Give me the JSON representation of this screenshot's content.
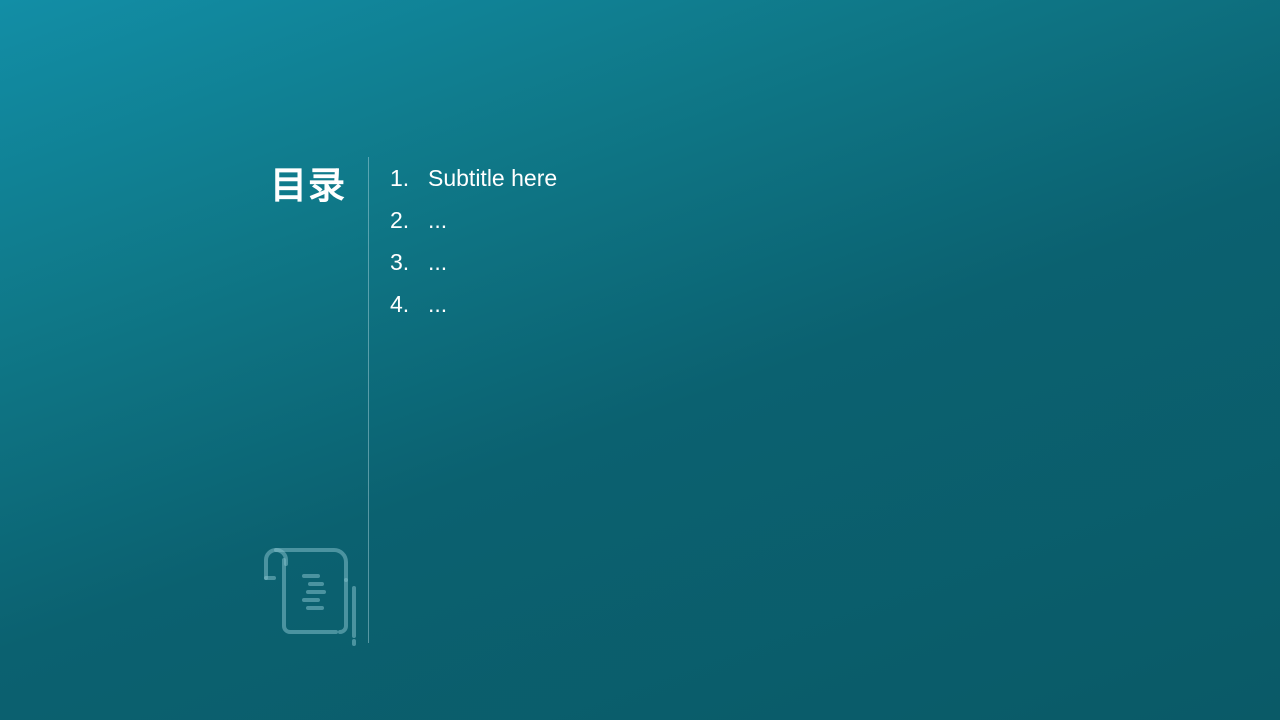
{
  "slide": {
    "heading": "目录",
    "items": [
      {
        "number": "1.",
        "text": "Subtitle here"
      },
      {
        "number": "2.",
        "text": "..."
      },
      {
        "number": "3.",
        "text": "..."
      },
      {
        "number": "4.",
        "text": "..."
      }
    ],
    "icon": "scroll-document-icon",
    "colors": {
      "background_top_left": "#128ea6",
      "background_bottom_right": "#0a5a67",
      "text": "#ffffff"
    }
  }
}
